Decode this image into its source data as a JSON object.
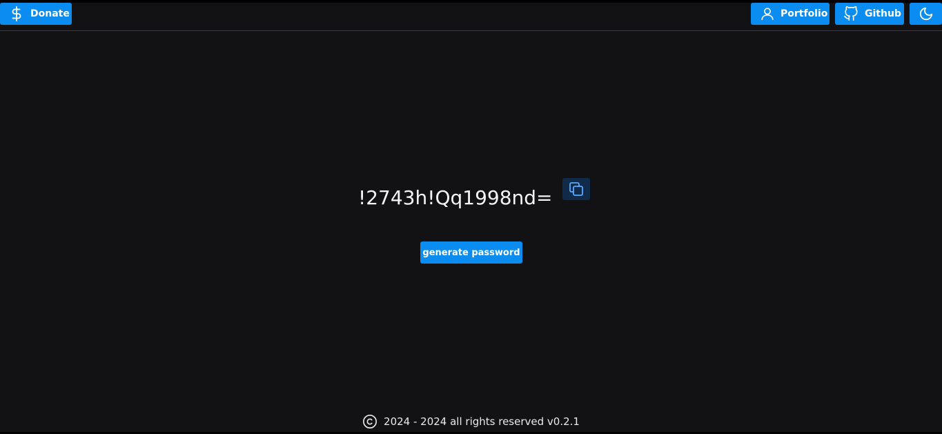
{
  "header": {
    "donate_label": "Donate",
    "portfolio_label": "Portfolio",
    "github_label": "Github",
    "donate_icon": "dollar-icon",
    "portfolio_icon": "user-icon",
    "github_icon": "github-icon",
    "theme_icon": "moon-icon"
  },
  "main": {
    "password": "!2743h!Qq1998nd=",
    "copy_icon": "copy-icon",
    "generate_label": "generate password"
  },
  "footer": {
    "icon": "copyright-icon",
    "text": "2024 - 2024 all rights reserved v0.2.1"
  },
  "colors": {
    "background": "#121214",
    "accent": "#0a8cf0",
    "copy_button_bg": "#102a4a"
  }
}
